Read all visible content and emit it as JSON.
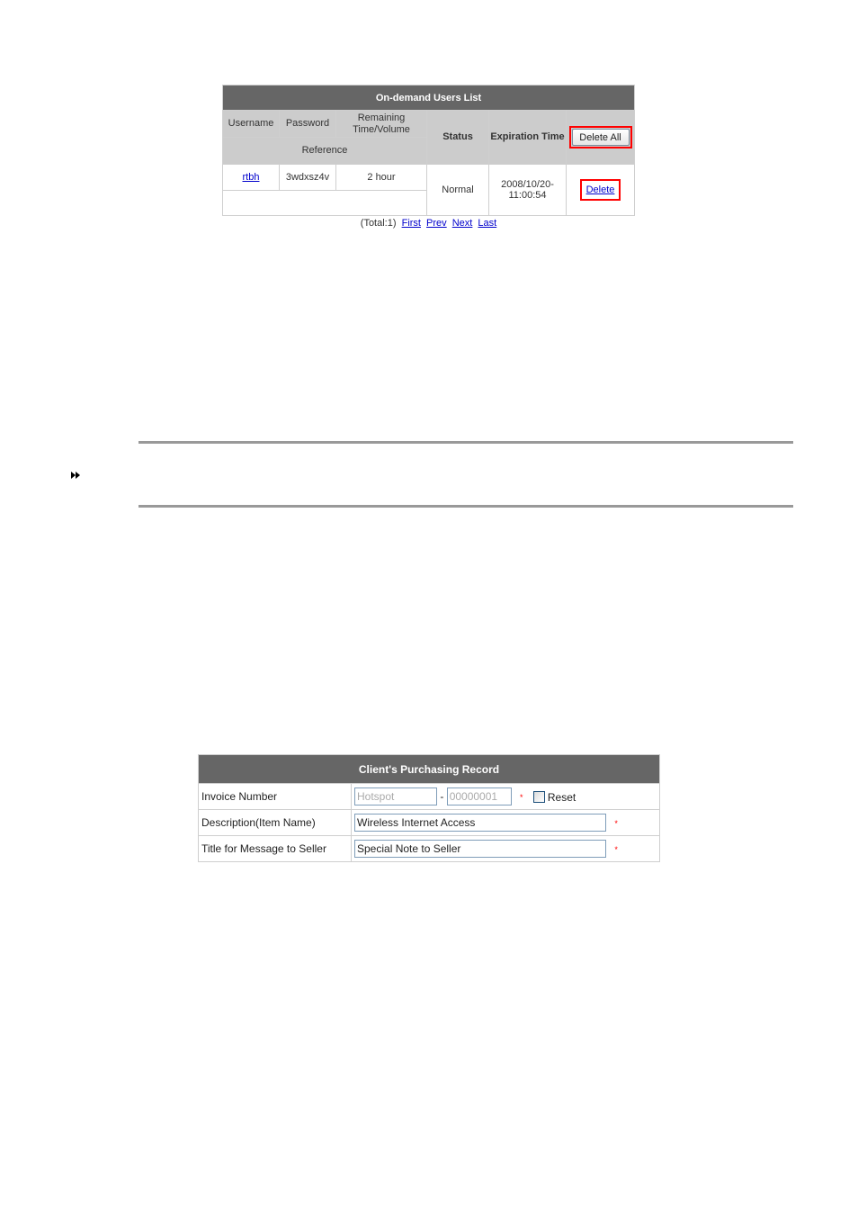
{
  "users_list": {
    "title": "On-demand Users List",
    "headers": {
      "username": "Username",
      "password": "Password",
      "remaining": "Remaining Time/Volume",
      "reference": "Reference",
      "status": "Status",
      "expiration": "Expiration Time",
      "delete_all_button": "Delete All"
    },
    "rows": [
      {
        "username": "rtbh",
        "password": "3wdxsz4v",
        "remaining": "2 hour",
        "reference": "",
        "status": "Normal",
        "expiration_date": "2008/10/20-",
        "expiration_time": "11:00:54",
        "delete_link": "Delete"
      }
    ],
    "pager": {
      "total": "(Total:1)",
      "first": "First",
      "prev": "Prev",
      "next": "Next",
      "last": "Last"
    }
  },
  "note": {
    "icon": "double-arrow-icon",
    "glyph": "⏩"
  },
  "purchasing_record": {
    "title": "Client's Purchasing Record",
    "rows": [
      {
        "label": "Invoice Number",
        "prefix_value": "Hotspot",
        "separator": "-",
        "number_value": "00000001",
        "required": "*",
        "reset_label": "Reset",
        "reset_checked": false
      },
      {
        "label": "Description(Item Name)",
        "value": "Wireless Internet Access",
        "required": "*"
      },
      {
        "label": "Title for Message to Seller",
        "value": "Special Note to Seller",
        "required": "*"
      }
    ]
  },
  "colors": {
    "header_bg": "#666666",
    "subheader_bg": "#cccccc",
    "highlight_border": "#ff0000",
    "link": "#0000cc",
    "rule": "#999999"
  }
}
